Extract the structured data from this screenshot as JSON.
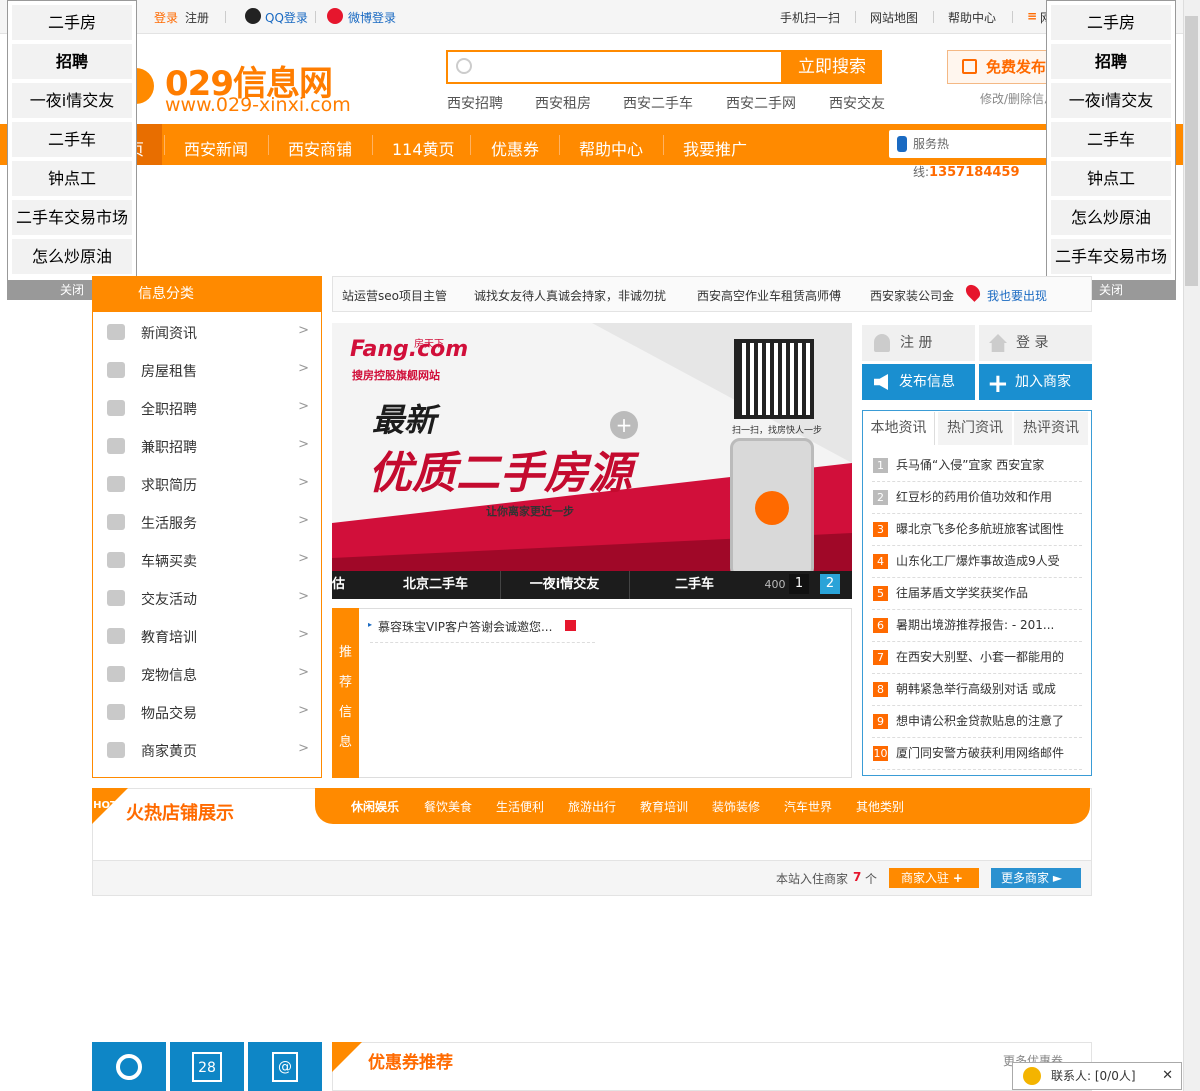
{
  "topbar": {
    "login": "登录",
    "register": "注册",
    "qq_login": "QQ登录",
    "weibo_login": "微博登录",
    "scan": "手机扫一扫",
    "sitemap": "网站地图",
    "help": "帮助中心",
    "more": "网"
  },
  "logo": {
    "name": "029信息网",
    "url": "www.029-xinxi.com"
  },
  "search": {
    "button": "立即搜索",
    "placeholder": "",
    "hot": [
      "西安招聘",
      "西安租房",
      "西安二手车",
      "西安二手网",
      "西安交友"
    ]
  },
  "header": {
    "post_free": "免费发布",
    "modify": "修改/删除信息"
  },
  "nav": {
    "items": [
      "页",
      "西安新闻",
      "西安商铺",
      "114黄页",
      "优惠券",
      "帮助中心",
      "我要推广"
    ],
    "hotline_label": "服务热线:",
    "hotline_number": "1357184459"
  },
  "floater_left": {
    "items": [
      "二手房",
      "招聘",
      "一夜i情交友",
      "二手车",
      "钟点工",
      "二手车交易市场",
      "怎么炒原油"
    ],
    "close": "关闭"
  },
  "floater_right": {
    "items": [
      "二手房",
      "招聘",
      "一夜i情交友",
      "二手车",
      "钟点工",
      "怎么炒原油",
      "二手车交易市场"
    ],
    "close": "关闭"
  },
  "category": {
    "title": "信息分类",
    "items": [
      "新闻资讯",
      "房屋租售",
      "全职招聘",
      "兼职招聘",
      "求职简历",
      "生活服务",
      "车辆买卖",
      "交友活动",
      "教育培训",
      "宠物信息",
      "物品交易",
      "商家黄页"
    ]
  },
  "notice": {
    "items": [
      "站运营seo项目主管",
      "诚找女友待人真诚会持家，非诚勿扰",
      "西安高空作业车租赁高师傅",
      "西安家装公司金"
    ],
    "link": "我也要出现"
  },
  "banner": {
    "brand": "Fang.com",
    "brand_cn": "房天下",
    "tagline": "搜房控股旗舰网站",
    "title_small": "最新",
    "title_big": "优质二手房源",
    "slogan": "让你离家更近一步",
    "qr_caption": "扫一扫，找房快人一步",
    "tabs": [
      "估",
      "北京二手车",
      "一夜i情交友",
      "二手车"
    ],
    "pages": [
      "1",
      "2"
    ],
    "tail": "400"
  },
  "recommend": {
    "label_chars": [
      "推",
      "荐",
      "信",
      "息"
    ],
    "items": [
      "慕容珠宝VIP客户答谢会诚邀您..."
    ]
  },
  "account": {
    "register": "注 册",
    "login": "登 录",
    "post_info": "发布信息",
    "join_merchant": "加入商家"
  },
  "news": {
    "tabs": [
      "本地资讯",
      "热门资讯",
      "热评资讯"
    ],
    "items": [
      "兵马俑“入侵”宜家 西安宜家",
      "红豆杉的药用价值功效和作用",
      "曝北京飞多伦多航班旅客试图性",
      "山东化工厂爆炸事故造成9人受",
      "往届茅盾文学奖获奖作品",
      "暑期出境游推荐报告: - 201...",
      "在西安大别墅、小套一都能用的",
      "朝韩紧急举行高级别对话 或成",
      "想申请公积金贷款贴息的注意了",
      "厦门同安警方破获利用网络邮件"
    ]
  },
  "shops": {
    "title": "火热店铺展示",
    "hot_badge": "HOT",
    "tabs": [
      "休闲娱乐",
      "餐饮美食",
      "生活便利",
      "旅游出行",
      "教育培训",
      "装饰装修",
      "汽车世界",
      "其他类别"
    ],
    "count_label": "本站入住商家",
    "count": "7",
    "count_unit": "个",
    "join_btn": "商家入驻",
    "more_btn": "更多商家"
  },
  "coupon": {
    "title": "优惠券推荐",
    "more": "更多优惠券"
  },
  "bottom_icons": {
    "date": "28",
    "at": "@"
  },
  "contact": {
    "label": "联系人: [0/0人]"
  },
  "colors": {
    "orange": "#ff8a00",
    "blue": "#0e86c6",
    "link_blue": "#1a6ac2"
  }
}
